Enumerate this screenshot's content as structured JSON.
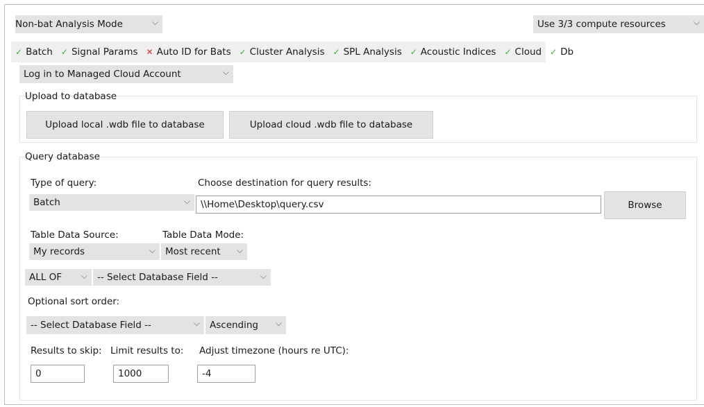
{
  "mode_select": {
    "value": "Non-bat Analysis Mode"
  },
  "compute_select": {
    "value": "Use 3/3 compute resources"
  },
  "tabs": [
    {
      "label": "Batch",
      "status": "ok",
      "mark": "✓"
    },
    {
      "label": "Signal Params",
      "status": "ok",
      "mark": "✓"
    },
    {
      "label": "Auto ID for Bats",
      "status": "bad",
      "mark": "✕"
    },
    {
      "label": "Cluster Analysis",
      "status": "ok",
      "mark": "✓"
    },
    {
      "label": "SPL Analysis",
      "status": "ok",
      "mark": "✓"
    },
    {
      "label": "Acoustic Indices",
      "status": "ok",
      "mark": "✓"
    },
    {
      "label": "Cloud",
      "status": "ok",
      "mark": "✓"
    },
    {
      "label": "Db",
      "status": "ok",
      "mark": "✓"
    }
  ],
  "login_select": {
    "value": "Log in to Managed Cloud Account"
  },
  "upload": {
    "title": "Upload to database",
    "local_button": "Upload local .wdb file to database",
    "cloud_button": "Upload cloud .wdb file to database"
  },
  "query": {
    "title": "Query database",
    "type_label": "Type of query:",
    "type_value": "Batch",
    "dest_label": "Choose destination for query results:",
    "dest_value": "\\\\Home\\Desktop\\query.csv",
    "browse_button": "Browse",
    "source_label": "Table Data Source:",
    "source_value": "My records",
    "mode_label": "Table Data Mode:",
    "mode_value": "Most recent",
    "logic_value": "ALL OF",
    "field_value": "-- Select Database Field --",
    "sort_label": "Optional sort order:",
    "sort_field_value": "-- Select Database Field --",
    "sort_dir_value": "Ascending",
    "skip_label": "Results to skip:",
    "skip_value": "0",
    "limit_label": "Limit results to:",
    "limit_value": "1000",
    "tz_label": "Adjust timezone (hours re UTC):",
    "tz_value": "-4"
  },
  "colors": {
    "ok": "#3fae3f",
    "bad": "#d63232",
    "control_bg": "#e3e3e3"
  },
  "icons": {
    "chevron": "chevron-down-icon",
    "ok": "check-icon",
    "bad": "x-icon"
  }
}
